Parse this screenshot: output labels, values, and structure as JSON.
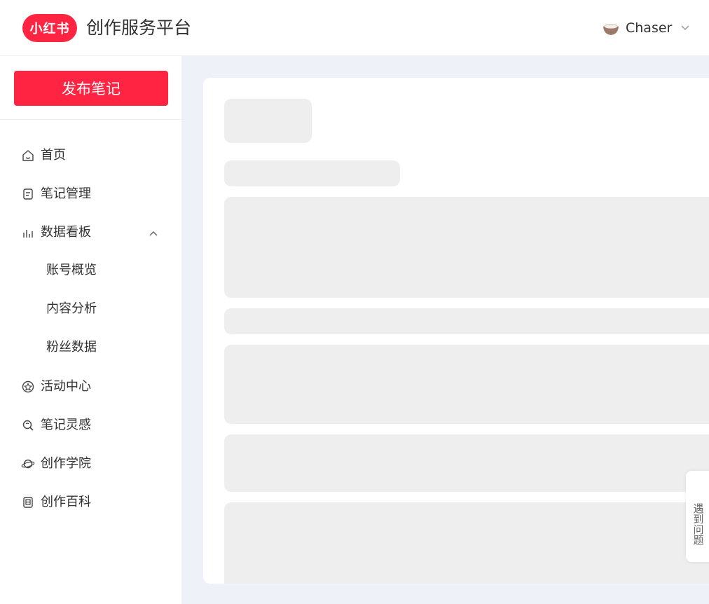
{
  "header": {
    "logo_text": "小红书",
    "app_title": "创作服务平台",
    "username": "Chaser"
  },
  "sidebar": {
    "publish_label": "发布笔记",
    "items": [
      {
        "label": "首页",
        "icon": "home-icon"
      },
      {
        "label": "笔记管理",
        "icon": "note-icon"
      },
      {
        "label": "数据看板",
        "icon": "chart-icon",
        "expanded": true,
        "sub_items": [
          {
            "label": "账号概览"
          },
          {
            "label": "内容分析"
          },
          {
            "label": "粉丝数据"
          }
        ]
      },
      {
        "label": "活动中心",
        "icon": "activity-icon"
      },
      {
        "label": "笔记灵感",
        "icon": "inspiration-icon"
      },
      {
        "label": "创作学院",
        "icon": "academy-icon"
      },
      {
        "label": "创作百科",
        "icon": "encyclopedia-icon"
      }
    ]
  },
  "help": {
    "label": "遇到问题"
  },
  "colors": {
    "brand": "#ff2442",
    "main_bg": "#eef1f8",
    "skeleton": "#eeeeee"
  }
}
